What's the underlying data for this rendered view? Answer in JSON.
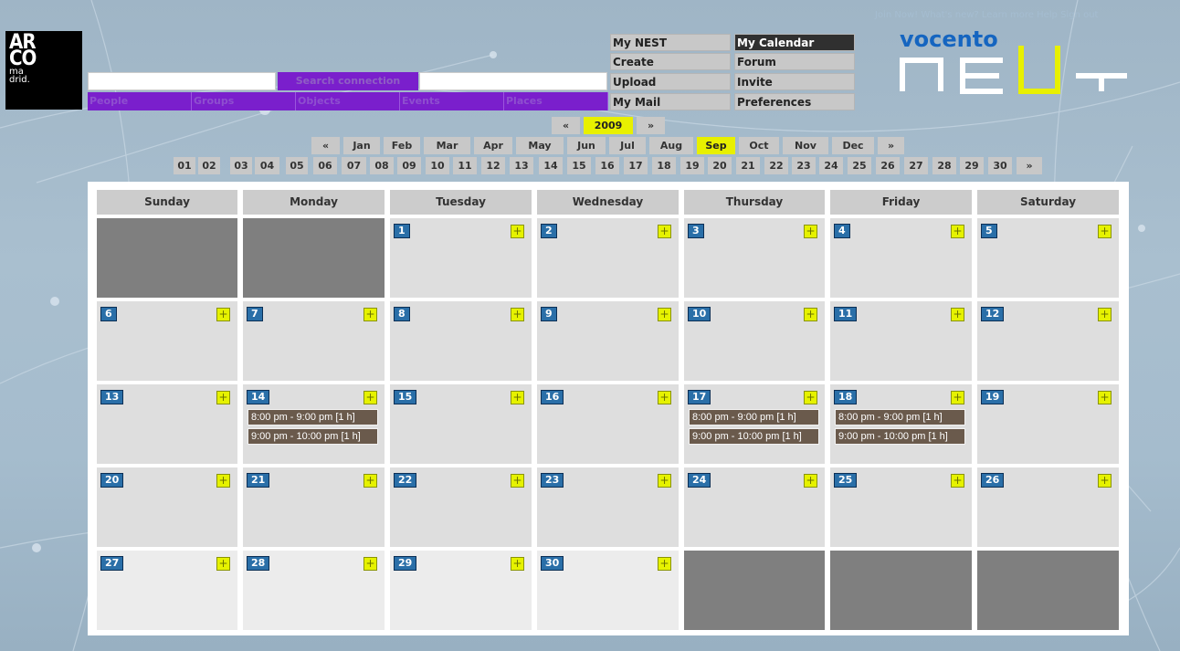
{
  "logo": {
    "line1": "AR",
    "line2": "CO",
    "line3": "ma",
    "line4": "drid."
  },
  "search": {
    "button_label": "Search connection",
    "input_value": "",
    "input2_value": ""
  },
  "tabs": [
    "People",
    "Groups",
    "Objects",
    "Events",
    "Places"
  ],
  "menu": {
    "col1": [
      "My NEST",
      "Create",
      "Upload",
      "My Mail"
    ],
    "col2": [
      "My Calendar",
      "Forum",
      "Invite",
      "Preferences"
    ],
    "active": "My Calendar"
  },
  "top_links": "Join Now! What's new? Learn more Help Sign out",
  "brand": {
    "vocento": "vocento",
    "nest": "NEST"
  },
  "year_nav": {
    "prev": "«",
    "year": "2009",
    "next": "»"
  },
  "month_nav": {
    "prev": "«",
    "months": [
      "Jan",
      "Feb",
      "Mar",
      "Apr",
      "May",
      "Jun",
      "Jul",
      "Aug",
      "Sep",
      "Oct",
      "Nov",
      "Dec"
    ],
    "selected": "Sep",
    "next": "»"
  },
  "day_nav": {
    "days": [
      "01",
      "02",
      "03",
      "04",
      "05",
      "06",
      "07",
      "08",
      "09",
      "10",
      "11",
      "12",
      "13",
      "14",
      "15",
      "16",
      "17",
      "18",
      "19",
      "20",
      "21",
      "22",
      "23",
      "24",
      "25",
      "26",
      "27",
      "28",
      "29",
      "30"
    ],
    "next": "»"
  },
  "calendar": {
    "weekdays": [
      "Sunday",
      "Monday",
      "Tuesday",
      "Wednesday",
      "Thursday",
      "Friday",
      "Saturday"
    ],
    "weeks": [
      [
        null,
        null,
        {
          "day": "1"
        },
        {
          "day": "2"
        },
        {
          "day": "3"
        },
        {
          "day": "4"
        },
        {
          "day": "5"
        }
      ],
      [
        {
          "day": "6"
        },
        {
          "day": "7"
        },
        {
          "day": "8"
        },
        {
          "day": "9"
        },
        {
          "day": "10"
        },
        {
          "day": "11"
        },
        {
          "day": "12"
        }
      ],
      [
        {
          "day": "13"
        },
        {
          "day": "14",
          "events": [
            "8:00 pm - 9:00 pm [1 h]",
            "9:00 pm - 10:00 pm [1 h]"
          ]
        },
        {
          "day": "15"
        },
        {
          "day": "16"
        },
        {
          "day": "17",
          "events": [
            "8:00 pm - 9:00 pm [1 h]",
            "9:00 pm - 10:00 pm [1 h]"
          ]
        },
        {
          "day": "18",
          "events": [
            "8:00 pm - 9:00 pm [1 h]",
            "9:00 pm - 10:00 pm [1 h]"
          ]
        },
        {
          "day": "19"
        }
      ],
      [
        {
          "day": "20"
        },
        {
          "day": "21"
        },
        {
          "day": "22"
        },
        {
          "day": "23"
        },
        {
          "day": "24"
        },
        {
          "day": "25"
        },
        {
          "day": "26"
        }
      ],
      [
        {
          "day": "27"
        },
        {
          "day": "28"
        },
        {
          "day": "29"
        },
        {
          "day": "30"
        },
        null,
        null,
        null
      ]
    ],
    "add_label": "+"
  },
  "colors": {
    "accent_yellow": "#e8f000",
    "purple": "#7a1fcc",
    "day_blue": "#2a6fa8",
    "event_brown": "#6a5a4c"
  }
}
